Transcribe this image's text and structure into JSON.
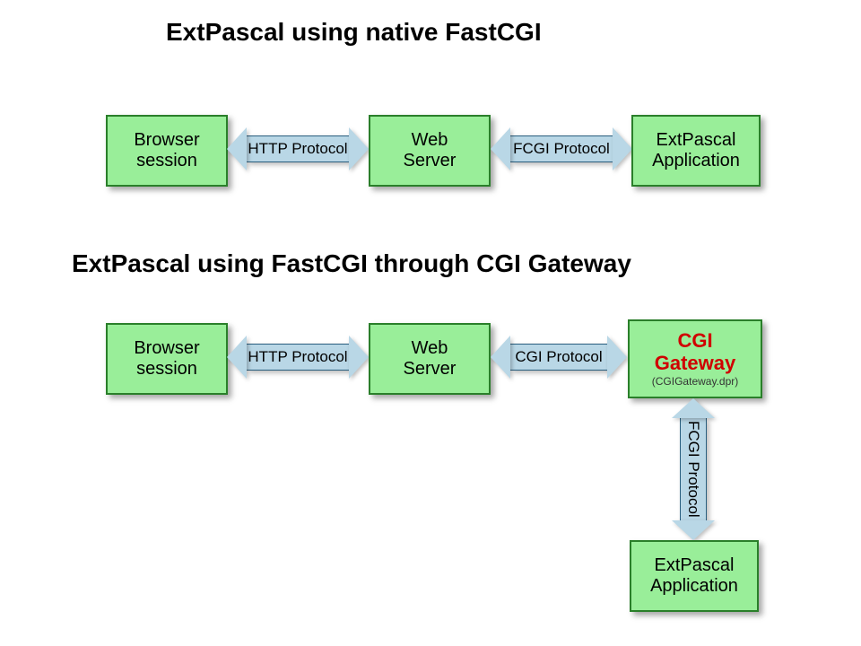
{
  "colors": {
    "box_fill": "#99ee99",
    "box_border": "#2a7f2a",
    "arrow_fill": "#b9d7e6",
    "highlight_text": "#d00000"
  },
  "diagram1": {
    "title": "ExtPascal using native FastCGI",
    "nodes": {
      "browser": {
        "line1": "Browser",
        "line2": "session"
      },
      "web": {
        "line1": "Web",
        "line2": "Server"
      },
      "app": {
        "line1": "ExtPascal",
        "line2": "Application"
      }
    },
    "connectors": {
      "http": "HTTP Protocol",
      "fcgi": "FCGI Protocol"
    }
  },
  "diagram2": {
    "title": "ExtPascal using FastCGI through CGI Gateway",
    "nodes": {
      "browser": {
        "line1": "Browser",
        "line2": "session"
      },
      "web": {
        "line1": "Web",
        "line2": "Server"
      },
      "gateway": {
        "line1": "CGI",
        "line2": "Gateway",
        "sub": "(CGIGateway.dpr)"
      },
      "app": {
        "line1": "ExtPascal",
        "line2": "Application"
      }
    },
    "connectors": {
      "http": "HTTP Protocol",
      "cgi": "CGI Protocol",
      "fcgi": "FCGI Protocol"
    }
  }
}
